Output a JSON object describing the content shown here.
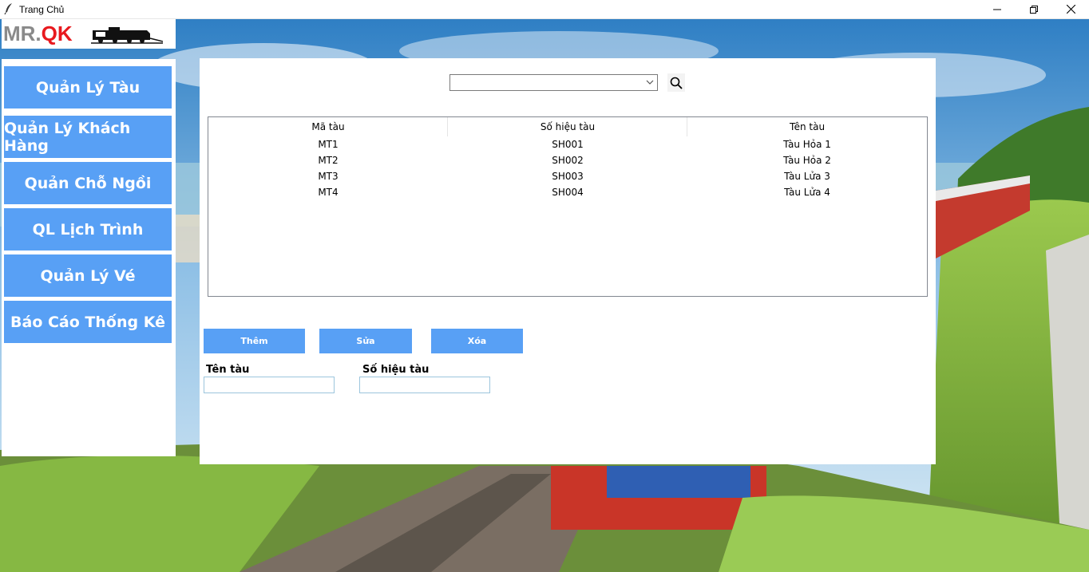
{
  "window": {
    "title": "Trang Chủ",
    "controls": [
      "minimize-icon",
      "maximize-icon",
      "close-icon"
    ]
  },
  "logo": {
    "part1": "MR.",
    "part2": "QK",
    "part1_color": "#8a8a8a",
    "part2_color": "#e8191e"
  },
  "sidebar": {
    "accent": "#58a0f5",
    "items": [
      {
        "label": "Quản Lý Tàu"
      },
      {
        "label": "Quản Lý Khách Hàng"
      },
      {
        "label": "Quản Chỗ Ngồi"
      },
      {
        "label": "QL Lịch Trình"
      },
      {
        "label": "Quản Lý Vé"
      },
      {
        "label": "Báo Cáo Thống Kê"
      }
    ]
  },
  "search": {
    "selected": "",
    "icon": "search-icon"
  },
  "table": {
    "columns": [
      "Mã tàu",
      "Số hiệu tàu",
      "Tên tàu"
    ],
    "rows": [
      [
        "MT1",
        "SH001",
        "Tàu Hỏa 1"
      ],
      [
        "MT2",
        "SH002",
        "Tàu Hỏa 2"
      ],
      [
        "MT3",
        "SH003",
        "Tàu Lửa 3"
      ],
      [
        "MT4",
        "SH004",
        "Tàu Lửa 4"
      ]
    ]
  },
  "actions": {
    "add": "Thêm",
    "edit": "Sửa",
    "delete": "Xóa"
  },
  "form": {
    "name_label": "Tên tàu",
    "name_value": "",
    "code_label": "Số hiệu tàu",
    "code_value": ""
  }
}
